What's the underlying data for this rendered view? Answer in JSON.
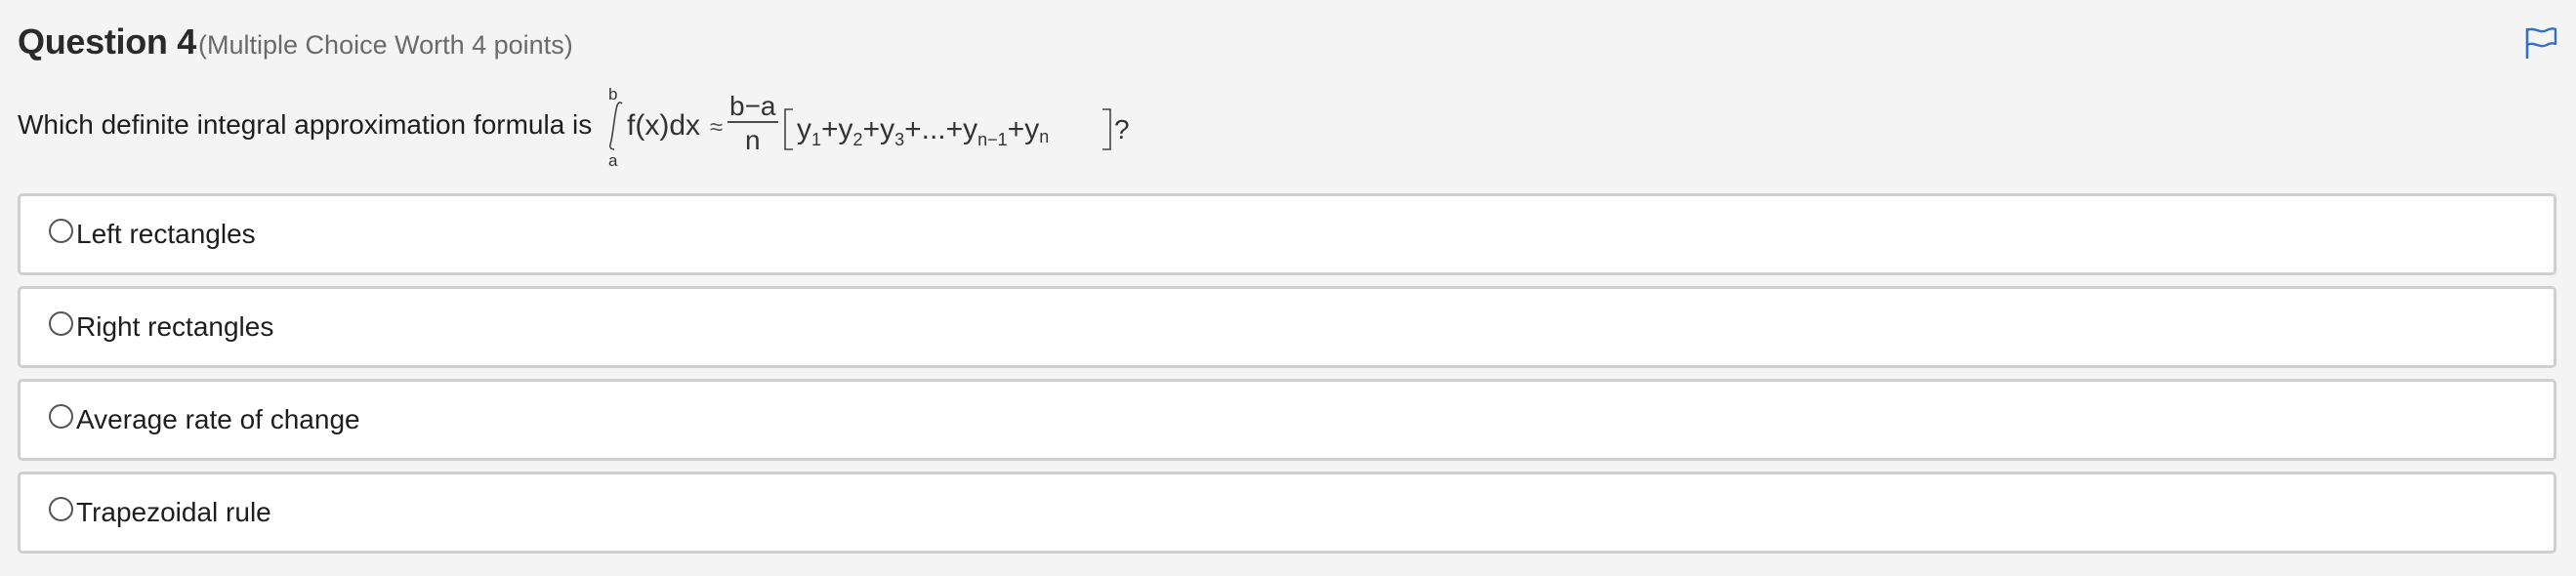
{
  "question": {
    "title": "Question 4",
    "meta": "(Multiple Choice Worth 4 points)",
    "prompt": "Which definite integral approximation formula is",
    "formula": {
      "upper_limit": "b",
      "lower_limit": "a",
      "integrand": "f(x)dx",
      "approx": "≈",
      "numerator": "b−a",
      "denominator": "n",
      "terms": [
        "y",
        "1",
        "+y",
        "2",
        "+y",
        "3",
        "+...+y",
        "n−1",
        "+y",
        "n"
      ],
      "suffix": "?"
    }
  },
  "flag": {
    "icon": "flag-icon",
    "color": "#2f6fd1"
  },
  "options": [
    {
      "label": "Left rectangles"
    },
    {
      "label": "Right rectangles"
    },
    {
      "label": "Average rate of change"
    },
    {
      "label": "Trapezoidal rule"
    }
  ]
}
